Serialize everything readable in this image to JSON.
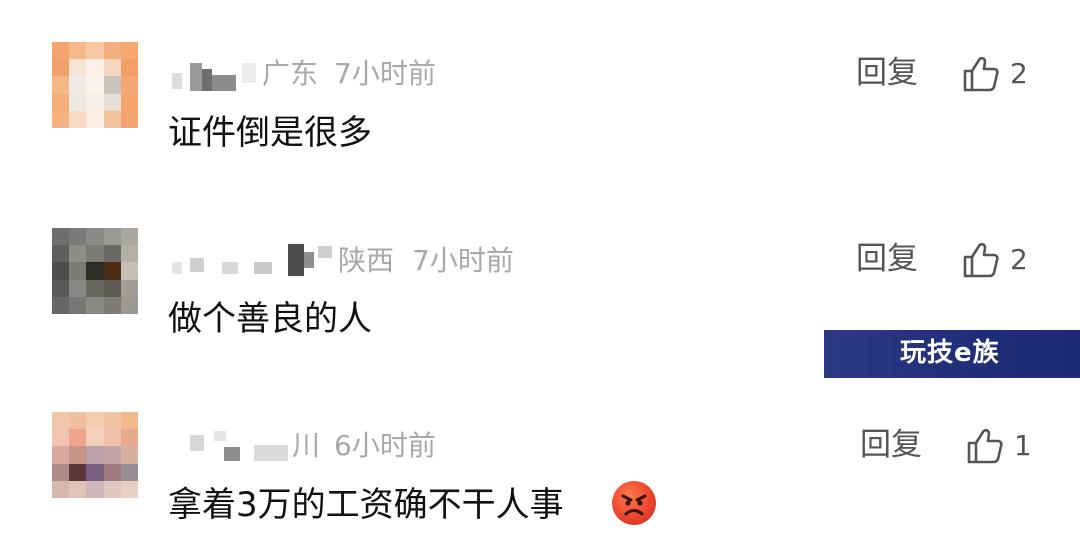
{
  "comments": [
    {
      "location": "广东",
      "time": "7小时前",
      "text": "证件倒是很多",
      "reply_label": "回复",
      "likes": "2"
    },
    {
      "location": "陕西",
      "time": "7小时前",
      "text": "做个善良的人",
      "reply_label": "回复",
      "likes": "2"
    },
    {
      "location": "川",
      "time": "6小时前",
      "text": "拿着3万的工资确不干人事",
      "reply_label": "回复",
      "likes": "1"
    }
  ],
  "watermark": {
    "text": "玩技e族",
    "color": "#1f2e78"
  },
  "icons": {
    "like": "thumbs-up-icon",
    "emoji": "angry-face-icon"
  }
}
